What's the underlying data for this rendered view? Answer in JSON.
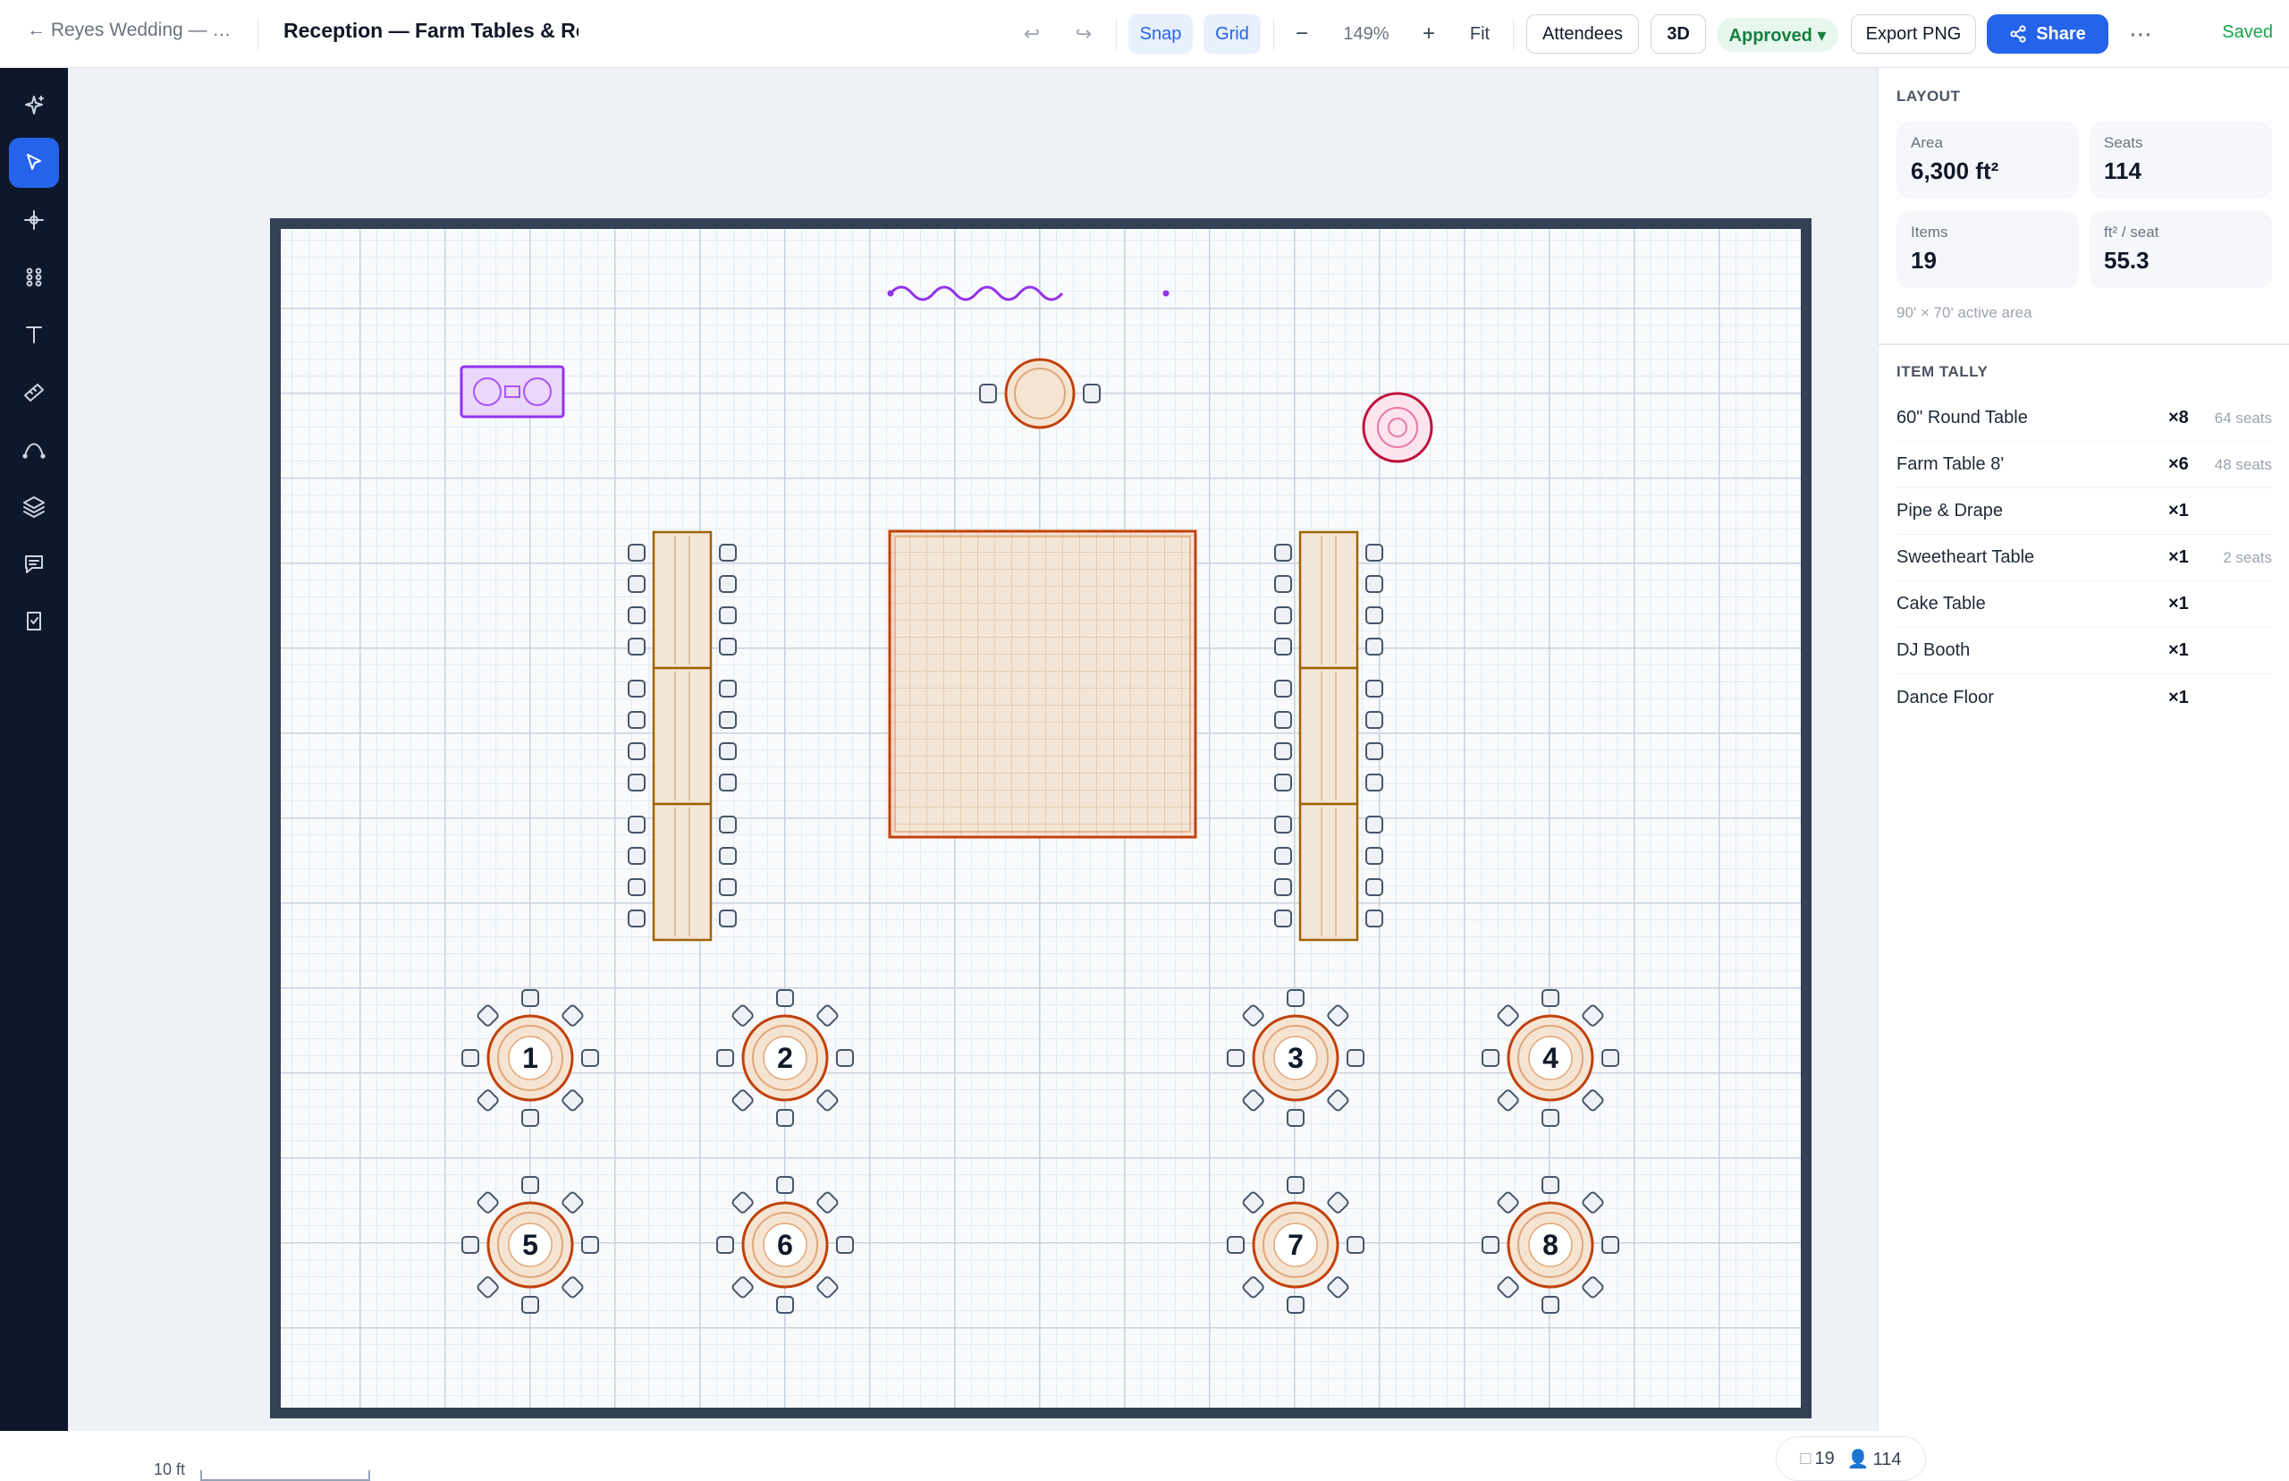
{
  "header": {
    "breadcrumb": "← Reyes Wedding — …",
    "title": "Reception — Farm Tables & Rou",
    "snap": "Snap",
    "grid": "Grid",
    "zoom_out": "−",
    "zoom": "149%",
    "zoom_in": "+",
    "fit": "Fit",
    "attendees": "Attendees",
    "view_3d": "3D",
    "status": "Approved ▾",
    "export": "Export PNG",
    "share": "Share",
    "more": "⋯",
    "saved": "Saved"
  },
  "tools": [
    "magic-wand-icon",
    "select-pointer-icon",
    "node-edit-icon",
    "grid-items-icon",
    "text-icon",
    "ruler-icon",
    "curve-icon",
    "layers-icon",
    "comment-icon",
    "checklist-icon"
  ],
  "canvas": {
    "table_numbers": [
      "1",
      "2",
      "3",
      "4",
      "5",
      "6",
      "7",
      "8"
    ],
    "scale_label": "10 ft",
    "item_count": "19",
    "seat_count": "114"
  },
  "layout_panel": {
    "heading": "LAYOUT",
    "stats": [
      {
        "label": "Area",
        "value": "6,300 ft²"
      },
      {
        "label": "Seats",
        "value": "114"
      },
      {
        "label": "Items",
        "value": "19"
      },
      {
        "label": "ft² / seat",
        "value": "55.3"
      }
    ],
    "area_note": "90' × 70' active area"
  },
  "tally_panel": {
    "heading": "ITEM TALLY",
    "items": [
      {
        "name": "60\" Round Table",
        "count": "×8",
        "seats": "64 seats"
      },
      {
        "name": "Farm Table 8'",
        "count": "×6",
        "seats": "48 seats"
      },
      {
        "name": "Pipe & Drape",
        "count": "×1",
        "seats": ""
      },
      {
        "name": "Sweetheart Table",
        "count": "×1",
        "seats": "2 seats"
      },
      {
        "name": "Cake Table",
        "count": "×1",
        "seats": ""
      },
      {
        "name": "DJ Booth",
        "count": "×1",
        "seats": ""
      },
      {
        "name": "Dance Floor",
        "count": "×1",
        "seats": ""
      }
    ]
  },
  "colors": {
    "accent": "#2563eb",
    "table_stroke": "#c2410c",
    "dance_floor": "#f3e6d6",
    "dj_booth": "#9333ea",
    "cake_table": "#be123c",
    "approved": "#15803d"
  }
}
